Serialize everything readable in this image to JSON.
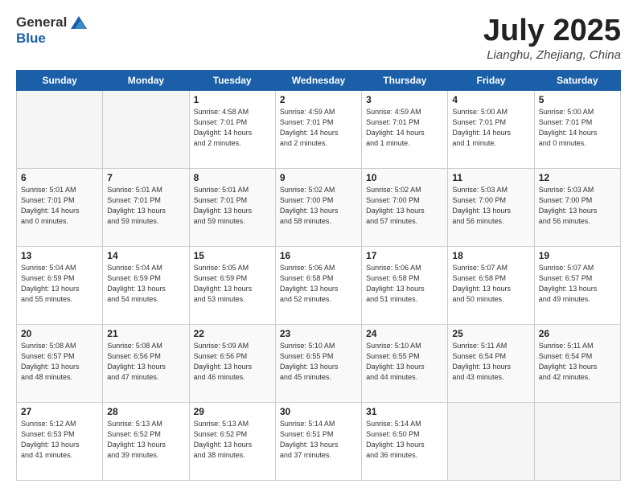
{
  "header": {
    "logo_general": "General",
    "logo_blue": "Blue",
    "month_title": "July 2025",
    "subtitle": "Lianghu, Zhejiang, China"
  },
  "weekdays": [
    "Sunday",
    "Monday",
    "Tuesday",
    "Wednesday",
    "Thursday",
    "Friday",
    "Saturday"
  ],
  "weeks": [
    [
      {
        "num": "",
        "info": ""
      },
      {
        "num": "",
        "info": ""
      },
      {
        "num": "1",
        "info": "Sunrise: 4:58 AM\nSunset: 7:01 PM\nDaylight: 14 hours\nand 2 minutes."
      },
      {
        "num": "2",
        "info": "Sunrise: 4:59 AM\nSunset: 7:01 PM\nDaylight: 14 hours\nand 2 minutes."
      },
      {
        "num": "3",
        "info": "Sunrise: 4:59 AM\nSunset: 7:01 PM\nDaylight: 14 hours\nand 1 minute."
      },
      {
        "num": "4",
        "info": "Sunrise: 5:00 AM\nSunset: 7:01 PM\nDaylight: 14 hours\nand 1 minute."
      },
      {
        "num": "5",
        "info": "Sunrise: 5:00 AM\nSunset: 7:01 PM\nDaylight: 14 hours\nand 0 minutes."
      }
    ],
    [
      {
        "num": "6",
        "info": "Sunrise: 5:01 AM\nSunset: 7:01 PM\nDaylight: 14 hours\nand 0 minutes."
      },
      {
        "num": "7",
        "info": "Sunrise: 5:01 AM\nSunset: 7:01 PM\nDaylight: 13 hours\nand 59 minutes."
      },
      {
        "num": "8",
        "info": "Sunrise: 5:01 AM\nSunset: 7:01 PM\nDaylight: 13 hours\nand 59 minutes."
      },
      {
        "num": "9",
        "info": "Sunrise: 5:02 AM\nSunset: 7:00 PM\nDaylight: 13 hours\nand 58 minutes."
      },
      {
        "num": "10",
        "info": "Sunrise: 5:02 AM\nSunset: 7:00 PM\nDaylight: 13 hours\nand 57 minutes."
      },
      {
        "num": "11",
        "info": "Sunrise: 5:03 AM\nSunset: 7:00 PM\nDaylight: 13 hours\nand 56 minutes."
      },
      {
        "num": "12",
        "info": "Sunrise: 5:03 AM\nSunset: 7:00 PM\nDaylight: 13 hours\nand 56 minutes."
      }
    ],
    [
      {
        "num": "13",
        "info": "Sunrise: 5:04 AM\nSunset: 6:59 PM\nDaylight: 13 hours\nand 55 minutes."
      },
      {
        "num": "14",
        "info": "Sunrise: 5:04 AM\nSunset: 6:59 PM\nDaylight: 13 hours\nand 54 minutes."
      },
      {
        "num": "15",
        "info": "Sunrise: 5:05 AM\nSunset: 6:59 PM\nDaylight: 13 hours\nand 53 minutes."
      },
      {
        "num": "16",
        "info": "Sunrise: 5:06 AM\nSunset: 6:58 PM\nDaylight: 13 hours\nand 52 minutes."
      },
      {
        "num": "17",
        "info": "Sunrise: 5:06 AM\nSunset: 6:58 PM\nDaylight: 13 hours\nand 51 minutes."
      },
      {
        "num": "18",
        "info": "Sunrise: 5:07 AM\nSunset: 6:58 PM\nDaylight: 13 hours\nand 50 minutes."
      },
      {
        "num": "19",
        "info": "Sunrise: 5:07 AM\nSunset: 6:57 PM\nDaylight: 13 hours\nand 49 minutes."
      }
    ],
    [
      {
        "num": "20",
        "info": "Sunrise: 5:08 AM\nSunset: 6:57 PM\nDaylight: 13 hours\nand 48 minutes."
      },
      {
        "num": "21",
        "info": "Sunrise: 5:08 AM\nSunset: 6:56 PM\nDaylight: 13 hours\nand 47 minutes."
      },
      {
        "num": "22",
        "info": "Sunrise: 5:09 AM\nSunset: 6:56 PM\nDaylight: 13 hours\nand 46 minutes."
      },
      {
        "num": "23",
        "info": "Sunrise: 5:10 AM\nSunset: 6:55 PM\nDaylight: 13 hours\nand 45 minutes."
      },
      {
        "num": "24",
        "info": "Sunrise: 5:10 AM\nSunset: 6:55 PM\nDaylight: 13 hours\nand 44 minutes."
      },
      {
        "num": "25",
        "info": "Sunrise: 5:11 AM\nSunset: 6:54 PM\nDaylight: 13 hours\nand 43 minutes."
      },
      {
        "num": "26",
        "info": "Sunrise: 5:11 AM\nSunset: 6:54 PM\nDaylight: 13 hours\nand 42 minutes."
      }
    ],
    [
      {
        "num": "27",
        "info": "Sunrise: 5:12 AM\nSunset: 6:53 PM\nDaylight: 13 hours\nand 41 minutes."
      },
      {
        "num": "28",
        "info": "Sunrise: 5:13 AM\nSunset: 6:52 PM\nDaylight: 13 hours\nand 39 minutes."
      },
      {
        "num": "29",
        "info": "Sunrise: 5:13 AM\nSunset: 6:52 PM\nDaylight: 13 hours\nand 38 minutes."
      },
      {
        "num": "30",
        "info": "Sunrise: 5:14 AM\nSunset: 6:51 PM\nDaylight: 13 hours\nand 37 minutes."
      },
      {
        "num": "31",
        "info": "Sunrise: 5:14 AM\nSunset: 6:50 PM\nDaylight: 13 hours\nand 36 minutes."
      },
      {
        "num": "",
        "info": ""
      },
      {
        "num": "",
        "info": ""
      }
    ]
  ]
}
